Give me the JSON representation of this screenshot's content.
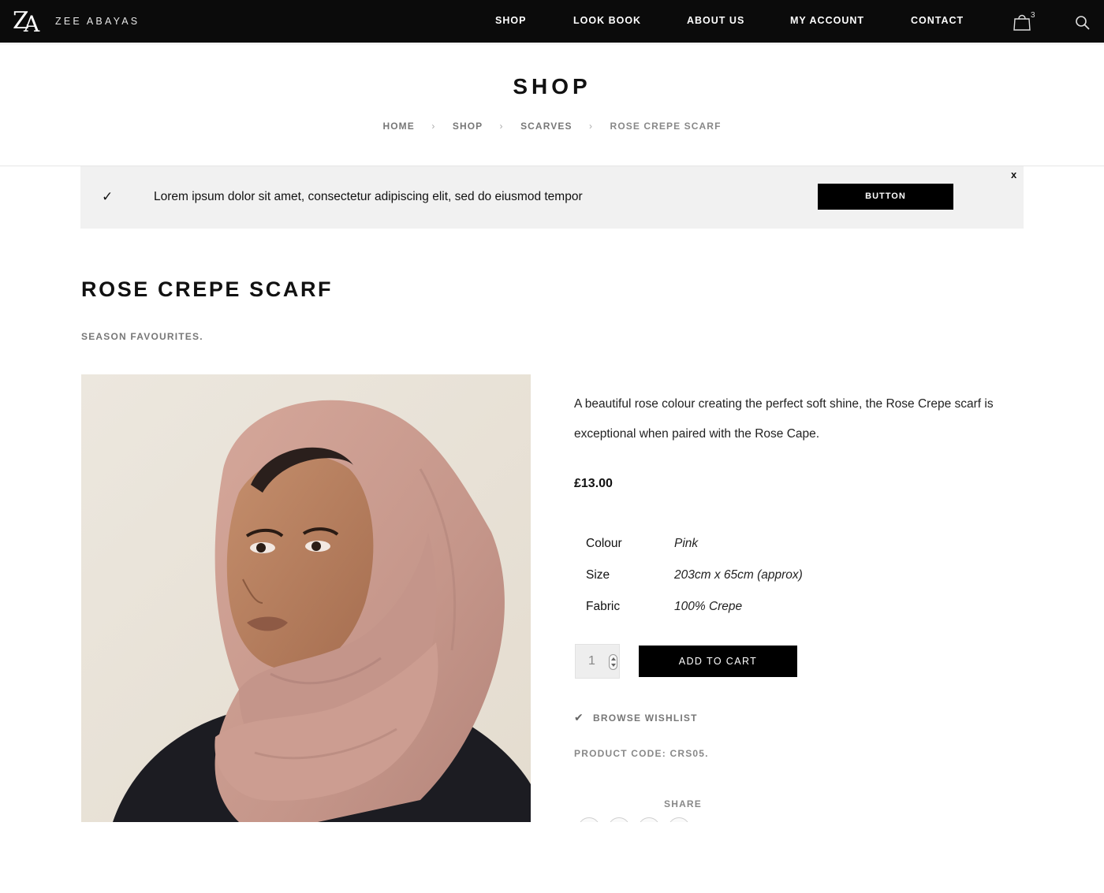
{
  "brand": {
    "logo_text": "ZEE ABAYAS",
    "logo_letters_z": "Z",
    "logo_letters_a": "A"
  },
  "nav": {
    "items": [
      "SHOP",
      "LOOK BOOK",
      "ABOUT US",
      "MY ACCOUNT",
      "CONTACT"
    ],
    "cart_count": "3",
    "cart_icon": "shopping-bag-icon",
    "search_icon": "search-icon"
  },
  "page": {
    "title": "SHOP",
    "breadcrumb": [
      "HOME",
      "SHOP",
      "SCARVES",
      "ROSE CREPE SCARF"
    ],
    "breadcrumb_sep": "›"
  },
  "notice": {
    "check": "✓",
    "text": "Lorem ipsum dolor sit amet, consectetur adipiscing elit, sed do eiusmod tempor",
    "button": "BUTTON",
    "close": "x"
  },
  "product": {
    "title": "ROSE CREPE SCARF",
    "subtitle": "SEASON FAVOURITES.",
    "description": "A beautiful rose colour creating the perfect soft shine, the Rose Crepe scarf is exceptional when paired with the Rose Cape.",
    "price": "£13.00",
    "attributes": [
      {
        "label": "Colour",
        "value": "Pink"
      },
      {
        "label": "Size",
        "value": "203cm x 65cm (approx)"
      },
      {
        "label": "Fabric",
        "value": "100% Crepe"
      }
    ],
    "quantity": "1",
    "add_to_cart": "ADD TO CART",
    "wishlist": "BROWSE WISHLIST",
    "code_label": "PRODUCT CODE:",
    "code_value": "CRS05.",
    "share_label": "SHARE"
  },
  "colors": {
    "header_bg": "#0b0b0b",
    "notice_bg": "#f1f1f1",
    "scarf": "#c99a8e",
    "button_bg": "#000000"
  }
}
